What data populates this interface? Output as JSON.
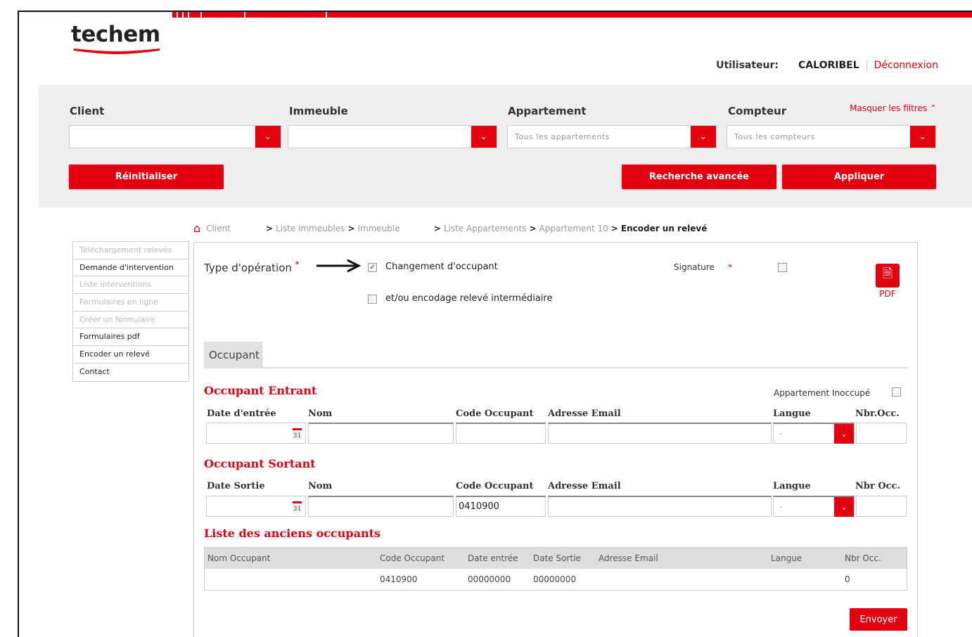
{
  "brand": {
    "logo": "techem",
    "accent": "#e3000f"
  },
  "header": {
    "user_label": "Utilisateur:",
    "user_name": "CALORIBEL",
    "logout": "Déconnexion"
  },
  "filters": {
    "client": {
      "label": "Client",
      "value": ""
    },
    "immeuble": {
      "label": "Immeuble",
      "value": ""
    },
    "appartement": {
      "label": "Appartement",
      "value": "Tous les appartements"
    },
    "compteur": {
      "label": "Compteur",
      "value": "Tous les compteurs"
    },
    "hide_filters": "Masquer les filtres",
    "reset_button": "Réinitialiser",
    "advanced_search_button": "Recherche avancée",
    "apply_button": "Appliquer"
  },
  "breadcrumb": {
    "items": [
      "Client",
      "Liste immeubles",
      "Immeuble",
      "Liste Appartements",
      "Appartement 10"
    ],
    "current": "Encoder un relevé",
    "sep": ">"
  },
  "sidebar": {
    "items": [
      {
        "label": "Téléchargement relevés",
        "enabled": false
      },
      {
        "label": "Demande d'intervention",
        "enabled": true
      },
      {
        "label": "Liste interventions",
        "enabled": false
      },
      {
        "label": "Formulaires en ligne",
        "enabled": false
      },
      {
        "label": "Créer un formulaire",
        "enabled": false
      },
      {
        "label": "Formulaires pdf",
        "enabled": true
      },
      {
        "label": "Encoder un relevé",
        "enabled": true
      },
      {
        "label": "Contact",
        "enabled": true
      }
    ]
  },
  "form": {
    "operation_label": "Type d'opération",
    "required_mark": "*",
    "opt_change_occupant": {
      "label": "Changement d'occupant",
      "checked": true
    },
    "opt_intermediate": {
      "label": "et/ou encodage relevé intermédiaire",
      "checked": false
    },
    "signature_label": "Signature",
    "signature_checked": false,
    "pdf_label": "PDF",
    "tab_occupant": "Occupant",
    "incoming": {
      "title": "Occupant Entrant",
      "vacant_label": "Appartement Inoccupé",
      "headers": [
        "Date d'entrée",
        "Nom",
        "Code Occupant",
        "Adresse Email",
        "Langue",
        "Nbr.Occ."
      ],
      "values": {
        "date": "",
        "name": "",
        "code": "",
        "email": "",
        "lang": "-",
        "count": ""
      }
    },
    "outgoing": {
      "title": "Occupant Sortant",
      "headers": [
        "Date Sortie",
        "Nom",
        "Code Occupant",
        "Adresse Email",
        "Langue",
        "Nbr Occ."
      ],
      "values": {
        "date": "",
        "name": "",
        "code": "0410900",
        "email": "",
        "lang": "-",
        "count": ""
      }
    },
    "former": {
      "title": "Liste des anciens occupants",
      "headers": [
        "Nom Occupant",
        "Code Occupant",
        "Date entrée",
        "Date Sortie",
        "Adresse Email",
        "Langue",
        "Nbr Occ."
      ],
      "rows": [
        {
          "name": "",
          "code": "0410900",
          "date_in": "00000000",
          "date_out": "00000000",
          "email": "",
          "lang": "",
          "count": "0"
        }
      ]
    },
    "send_button": "Envoyer"
  }
}
